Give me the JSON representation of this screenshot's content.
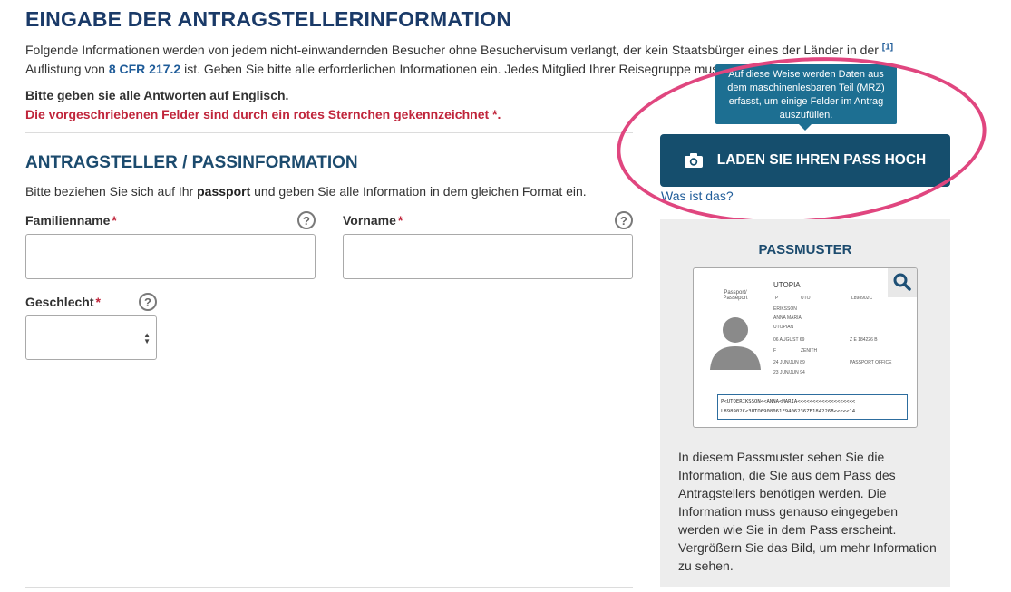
{
  "page": {
    "title": "EINGABE DER ANTRAGSTELLERINFORMATION",
    "intro_line1": "Folgende Informationen werden von jedem nicht-einwandernden Besucher ohne Besuchervisum verlangt, der kein Staatsbürger eines der Länder in der",
    "intro_ref": "[1]",
    "intro_line2_a": "Auflistung von",
    "intro_cfr": "8 CFR 217.2",
    "intro_line2_b": "ist. Geben Sie bitte alle erforderlichen Informationen ein. Jedes Mitglied Ihrer Reisegruppe muss",
    "english_note": "Bitte geben sie alle Antworten auf Englisch.",
    "required_note": "Die vorgeschriebenen Felder sind durch ein rotes Sternchen gekennzeichnet *."
  },
  "section": {
    "title": "ANTRAGSTELLER / PASSINFORMATION",
    "desc_a": "Bitte beziehen Sie sich auf Ihr",
    "desc_bold": "passport",
    "desc_b": "und geben Sie alle Information in dem gleichen Format ein."
  },
  "form": {
    "surname_label": "Familienname",
    "firstname_label": "Vorname",
    "gender_label": "Geschlecht",
    "required_mark": "*",
    "help_glyph": "?",
    "surname_value": "",
    "firstname_value": "",
    "gender_value": ""
  },
  "upload": {
    "tooltip": "Auf diese Weise werden Daten aus dem maschinenlesbaren Teil (MRZ) erfasst, um einige Felder im Antrag auszufüllen.",
    "button_label": "LADEN SIE IHREN PASS HOCH",
    "what_link": "Was ist das?"
  },
  "sample": {
    "title": "PASSMUSTER",
    "passport_country": "UTOPIA",
    "passport_word": "Passport/ Passeport",
    "fields": [
      "P",
      "UTO",
      "L898902C",
      "ERIKSSON",
      "ANNA MARIA",
      "UTOPIAN",
      "06 AUGUST 69",
      "F",
      "ZENITH",
      "24 JUN/JUN 89",
      "23 JUN/JUN 94",
      "PASSPORT OFFICE",
      "Z E 184226 B"
    ],
    "mrz_line1": "P<UTOERIKSSON<<ANNA<MARIA<<<<<<<<<<<<<<<<<<<",
    "mrz_line2": "L898902C<3UTO6908061F9406236ZE184226B<<<<<14",
    "description": "In diesem Passmuster sehen Sie die Information, die Sie aus dem Pass des Antragstellers benötigen werden. Die Information muss genauso eingegeben werden wie Sie in dem Pass erscheint. Vergrößern Sie das Bild, um mehr Information zu sehen."
  },
  "colors": {
    "title": "#1a3a68",
    "required": "#c0253b",
    "button": "#154e6d",
    "tooltip": "#1d6f92",
    "highlight": "#e0467f"
  }
}
